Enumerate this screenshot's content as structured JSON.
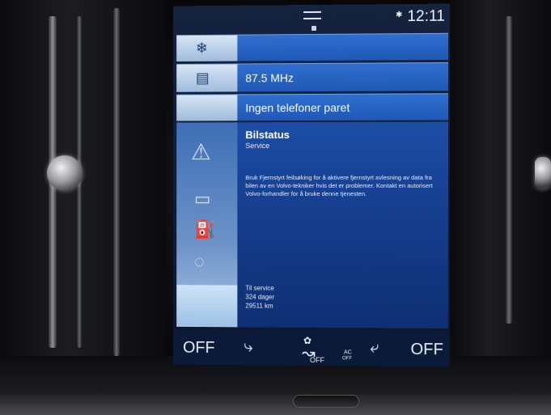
{
  "statusbar": {
    "time": "12:11",
    "signal_icon": "bluetooth-icon"
  },
  "tiles": [
    {
      "id": "climate-tile",
      "label": "",
      "icon": "fan-icon"
    },
    {
      "id": "radio-tile",
      "label": "87.5 MHz",
      "icon": "radio-icon"
    },
    {
      "id": "phone-tile",
      "label": "Ingen telefoner paret",
      "icon": "phone-icon"
    }
  ],
  "car_status": {
    "title": "Bilstatus",
    "subtitle": "Service",
    "message": "Bruk Fjernstyrt feilsøking for å aktivere fjernstyrt avlesning av data fra bilen av en Volvo-tekniker hvis det er problemer. Kontakt en autorisert Volvo-forhandler for å bruke denne tjenesten.",
    "service_label": "Til service",
    "service_days": "324 dager",
    "service_km": "29511 km",
    "side_icons": [
      "warning-icon",
      "car-icon",
      "fuel-icon",
      "tire-icon",
      "wrench-icon"
    ]
  },
  "climate_bar": {
    "left_temp": "OFF",
    "right_temp": "OFF",
    "fan_label": "OFF",
    "ac_label": "AC",
    "ac_sub": "OFF"
  },
  "colors": {
    "accent": "#2f6fd0",
    "screen_bg": "#0f1c36"
  }
}
